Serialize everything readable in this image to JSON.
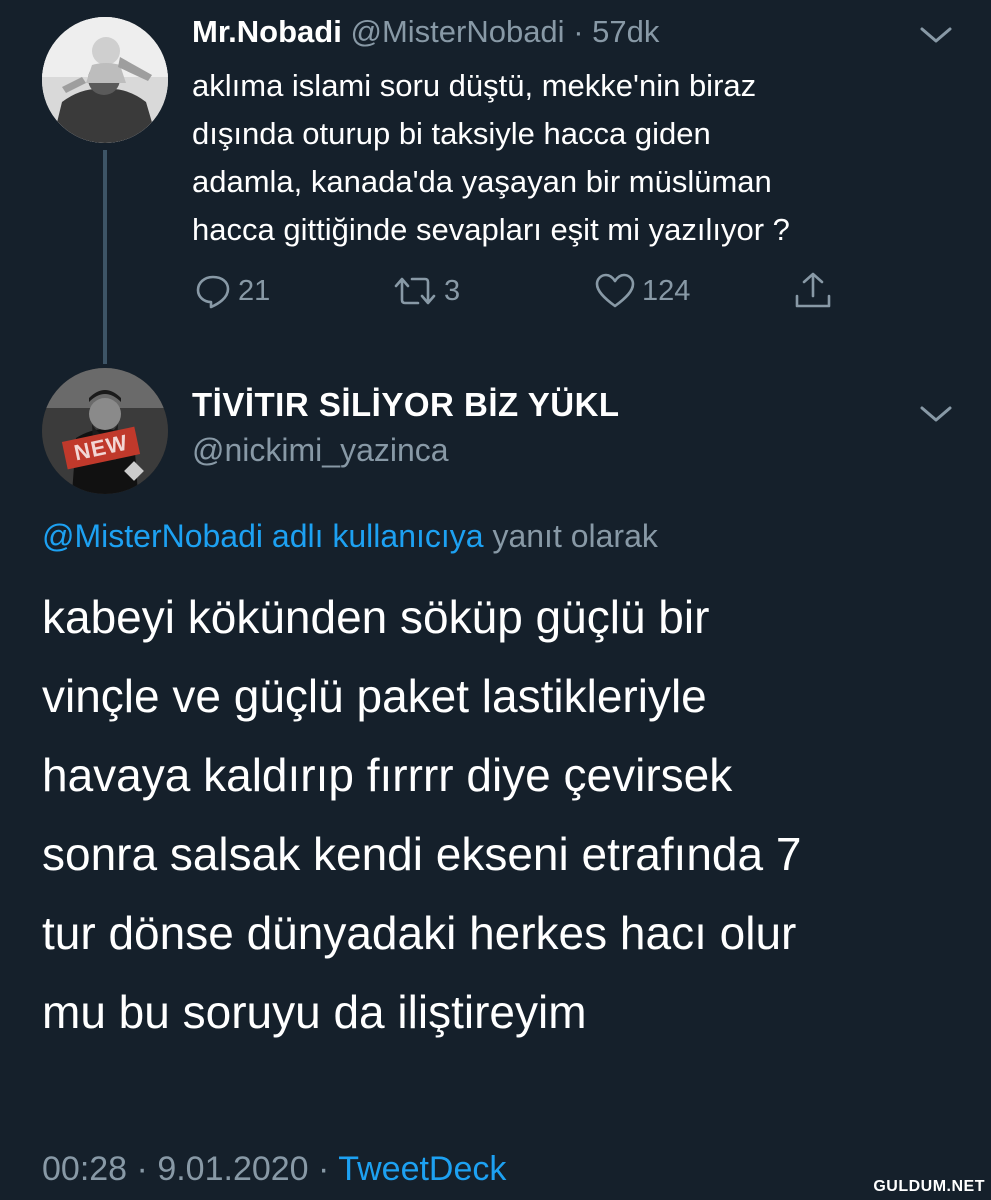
{
  "tweet1": {
    "display_name": "Mr.Nobadi",
    "handle": "@MisterNobadi",
    "time": "57dk",
    "text_lines": [
      "aklıma islami soru düştü, mekke'nin biraz",
      "dışında oturup bi taksiyle hacca giden",
      "adamla, kanada'da yaşayan bir müslüman",
      "hacca gittiğinde sevapları eşit mi yazılıyor ?"
    ],
    "replies": "21",
    "retweets": "3",
    "likes": "124"
  },
  "tweet2": {
    "display_name": "TİVİTIR SİLİYOR BİZ YÜKL",
    "handle": "@nickimi_yazinca",
    "reply_to_link": "@MisterNobadi adlı kullanıcıya",
    "reply_to_suffix": "yanıt olarak",
    "text_lines": [
      "kabeyi kökünden söküp güçlü bir",
      "vinçle ve güçlü paket lastikleriyle",
      "havaya kaldırıp fırrrr diye çevirsek",
      "sonra salsak kendi ekseni etrafında 7",
      "tur dönse dünyadaki herkes hacı olur",
      "mu bu soruyu da iliştireyim"
    ],
    "time": "00:28",
    "date": "9.01.2020",
    "source": "TweetDeck",
    "avatar_badge": "NEW"
  },
  "watermark": "GULDUM.NET",
  "colors": {
    "background": "#15202b",
    "text": "#ffffff",
    "muted": "#8899a6",
    "link": "#1da1f2"
  },
  "icons": [
    "reply-icon",
    "retweet-icon",
    "like-icon",
    "share-icon",
    "chevron-down-icon"
  ]
}
